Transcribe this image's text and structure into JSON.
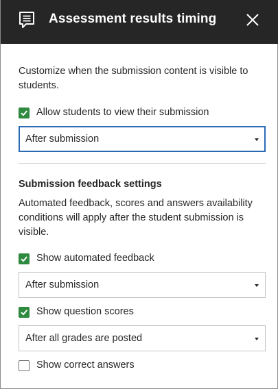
{
  "header": {
    "title": "Assessment results timing",
    "icon": "comment-list-icon",
    "close_icon": "close-icon"
  },
  "intro": {
    "line1": "Customize when the submission content is visible to",
    "line2": "students."
  },
  "view_submission": {
    "label": "Allow students to view their submission",
    "checked": true,
    "select_value": "After submission"
  },
  "feedback_section": {
    "heading": "Submission feedback settings",
    "desc_line1": "Automated feedback, scores and answers availability",
    "desc_line2": "conditions will apply after the student submission is",
    "desc_line3": "visible."
  },
  "automated_feedback": {
    "label": "Show automated feedback",
    "checked": true,
    "select_value": "After submission"
  },
  "question_scores": {
    "label": "Show question scores",
    "checked": true,
    "select_value": "After all grades are posted"
  },
  "correct_answers": {
    "label": "Show correct answers",
    "checked": false
  },
  "colors": {
    "header_bg": "#262626",
    "check_green": "#2d8a3e",
    "focus_blue": "#2a6ab4"
  }
}
